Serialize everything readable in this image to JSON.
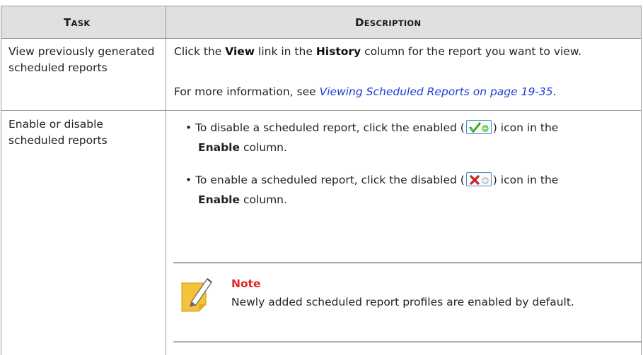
{
  "table": {
    "header": {
      "task": {
        "first": "T",
        "rest": "ASK"
      },
      "description": {
        "first": "D",
        "rest": "ESCRIPTION"
      }
    },
    "rows": [
      {
        "task": "View previously generated scheduled reports",
        "desc": {
          "p1_pre": "Click the ",
          "p1_b1": "View",
          "p1_mid": " link in the ",
          "p1_b2": "History",
          "p1_post": " column for the report you want to view.",
          "p2_pre": "For more information, see ",
          "p2_link": "Viewing Scheduled Reports on page 19-35",
          "p2_post": "."
        }
      },
      {
        "task": "Enable or disable scheduled reports",
        "bullets": [
          {
            "pre": "To disable a scheduled report, click the enabled (",
            "post": ") icon in the ",
            "bold": "Enable",
            "end": " column.",
            "icon": "enabled-icon"
          },
          {
            "pre": "To enable a scheduled report, click the disabled (",
            "post": ") icon in the ",
            "bold": "Enable",
            "end": " column.",
            "icon": "disabled-icon"
          }
        ],
        "note": {
          "title": "Note",
          "body": "Newly added scheduled report profiles are enabled by default."
        }
      }
    ]
  },
  "colors": {
    "link": "#1a3fd1",
    "note_title": "#e32424",
    "header_bg": "#e0e0e0",
    "icon_border": "#3a8fd6"
  }
}
